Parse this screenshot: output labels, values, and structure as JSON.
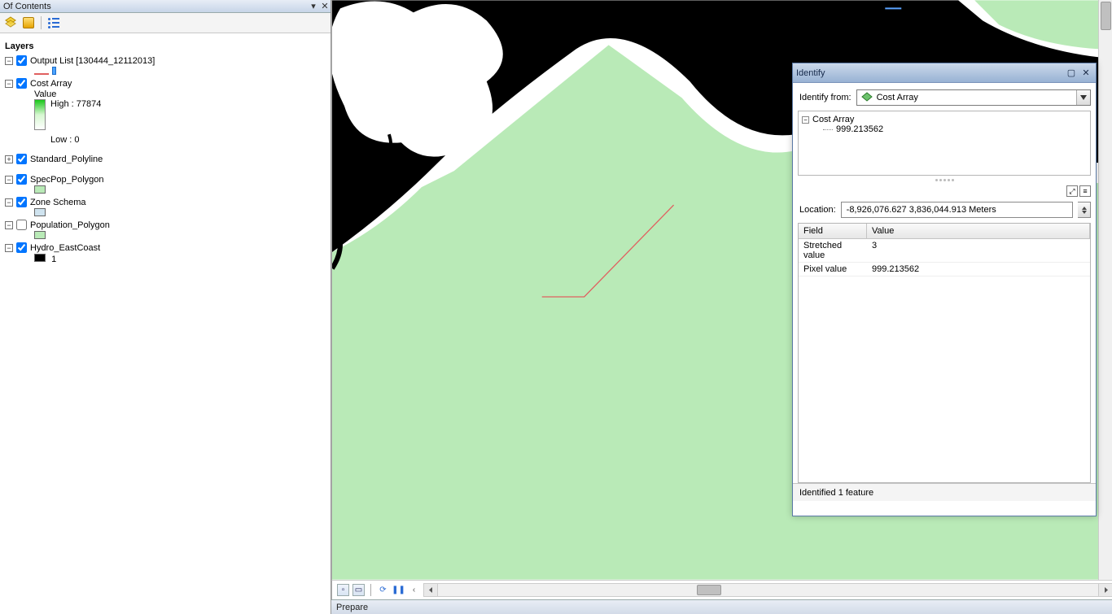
{
  "toc": {
    "title": "Of Contents",
    "group_title": "Layers",
    "toolbar": {
      "btn1": "list-by-drawing-order",
      "btn2": "list-by-source",
      "btn3": "list-by-selection"
    },
    "layers": [
      {
        "name": "Output List [130444_12112013]",
        "checked": true,
        "expanded": true,
        "type": "line"
      },
      {
        "name": "Cost Array",
        "checked": true,
        "expanded": true,
        "type": "raster",
        "raster": {
          "value_label": "Value",
          "high_label": "High : 77874",
          "low_label": "Low : 0"
        }
      },
      {
        "name": "Standard_Polyline",
        "checked": true,
        "expanded": false,
        "type": "line"
      },
      {
        "name": "SpecPop_Polygon",
        "checked": true,
        "expanded": true,
        "type": "polygon",
        "swatch": "green"
      },
      {
        "name": "Zone Schema",
        "checked": true,
        "expanded": true,
        "type": "polygon",
        "swatch": "lightblue"
      },
      {
        "name": "Population_Polygon",
        "checked": false,
        "expanded": true,
        "type": "polygon",
        "swatch": "green"
      },
      {
        "name": "Hydro_EastCoast",
        "checked": true,
        "expanded": true,
        "type": "polygon",
        "swatch": "black",
        "lbl": "1"
      }
    ]
  },
  "map": {
    "accent_green": "#b9eab7",
    "line_color": "#e06060"
  },
  "bottombar": {
    "btn_data": "data-view",
    "btn_layout": "layout-view"
  },
  "identify": {
    "title": "Identify",
    "from_label": "Identify from:",
    "from_value": "Cost Array",
    "tree_root": "Cost Array",
    "tree_value": "999.213562",
    "location_label": "Location:",
    "location_value": "-8,926,076.627 3,836,044.913 Meters",
    "grid": {
      "col_field": "Field",
      "col_value": "Value",
      "rows": [
        {
          "field": "Stretched value",
          "value": "3"
        },
        {
          "field": "Pixel value",
          "value": "999.213562"
        }
      ]
    },
    "status": "Identified 1 feature"
  },
  "status": {
    "text": "Prepare"
  }
}
